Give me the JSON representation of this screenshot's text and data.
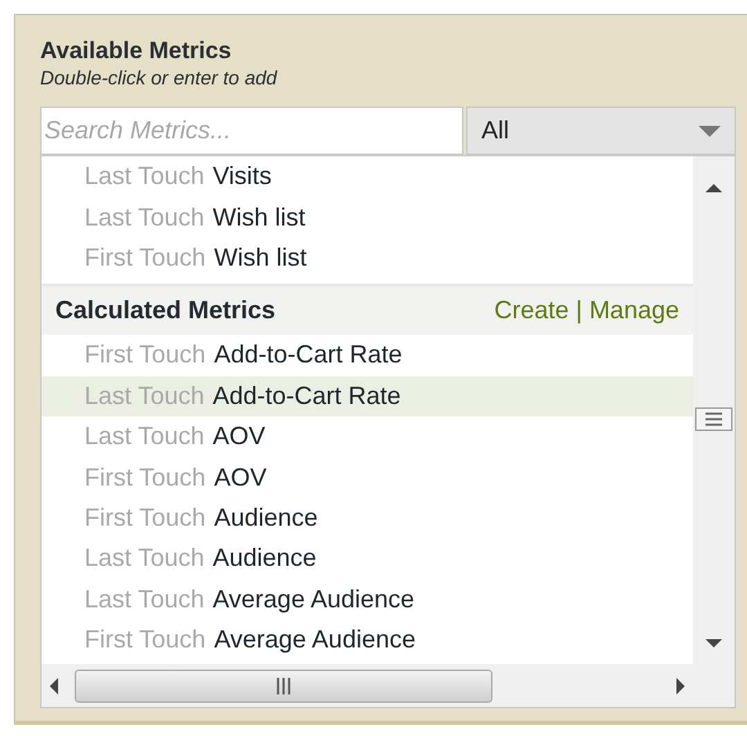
{
  "panel": {
    "title": "Available Metrics",
    "subtitle": "Double-click or enter to add"
  },
  "search": {
    "placeholder": "Search Metrics..."
  },
  "filter": {
    "value": "All"
  },
  "list": [
    {
      "kind": "item",
      "prefix": "Last Touch",
      "name": "Visits",
      "selected": false
    },
    {
      "kind": "item",
      "prefix": "Last Touch",
      "name": "Wish list",
      "selected": false
    },
    {
      "kind": "item",
      "prefix": "First Touch",
      "name": "Wish list",
      "selected": false
    },
    {
      "kind": "header",
      "title": "Calculated Metrics",
      "links": [
        "Create",
        "Manage"
      ]
    },
    {
      "kind": "item",
      "prefix": "First Touch",
      "name": "Add-to-Cart Rate",
      "selected": false
    },
    {
      "kind": "item",
      "prefix": "Last Touch",
      "name": "Add-to-Cart Rate",
      "selected": true
    },
    {
      "kind": "item",
      "prefix": "Last Touch",
      "name": "AOV",
      "selected": false
    },
    {
      "kind": "item",
      "prefix": "First Touch",
      "name": "AOV",
      "selected": false
    },
    {
      "kind": "item",
      "prefix": "First Touch",
      "name": "Audience",
      "selected": false
    },
    {
      "kind": "item",
      "prefix": "Last Touch",
      "name": "Audience",
      "selected": false
    },
    {
      "kind": "item",
      "prefix": "Last Touch",
      "name": "Average Audience",
      "selected": false
    },
    {
      "kind": "item",
      "prefix": "First Touch",
      "name": "Average Audience",
      "selected": false
    }
  ],
  "link_separator": "|"
}
